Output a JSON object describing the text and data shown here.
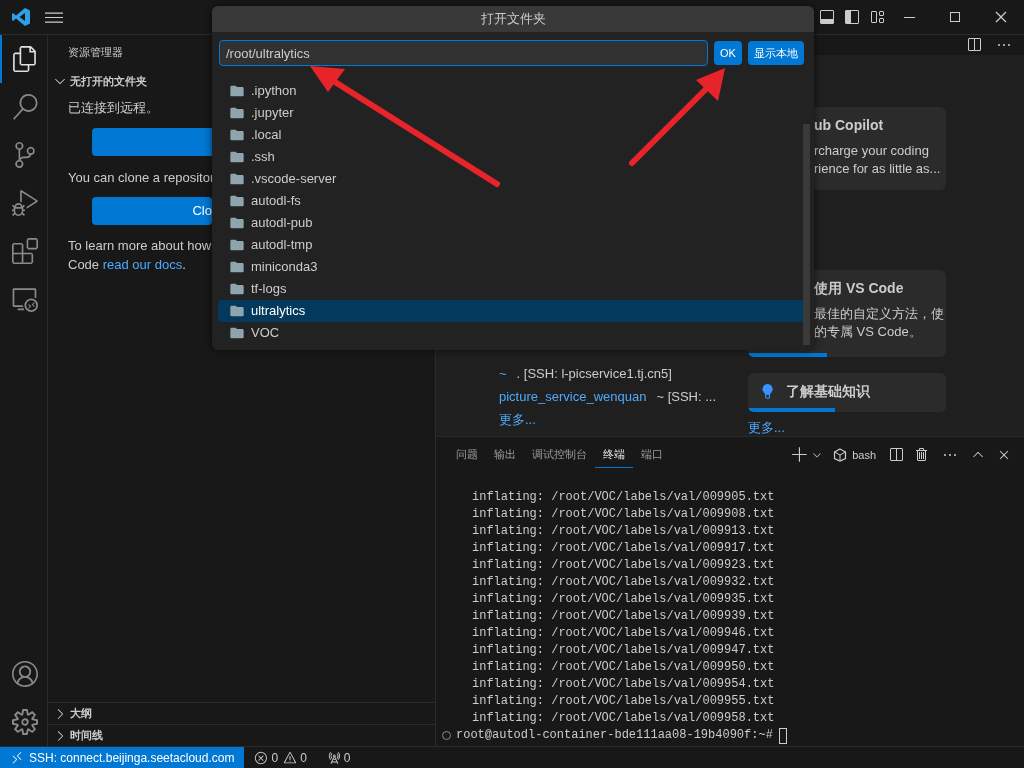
{
  "activity_bar": {
    "items": [
      {
        "kind": "files",
        "selected": true
      },
      {
        "kind": "search",
        "selected": false
      },
      {
        "kind": "source_control",
        "selected": false
      },
      {
        "kind": "run_debug",
        "selected": false
      },
      {
        "kind": "extensions",
        "selected": false
      },
      {
        "kind": "remote",
        "selected": false
      }
    ],
    "bottom": [
      {
        "kind": "account",
        "selected": false
      },
      {
        "kind": "settings",
        "selected": false
      }
    ]
  },
  "sidebar": {
    "title": "资源管理器",
    "section": {
      "label": "无打开的文件夹",
      "expanded": true
    },
    "connected_text": "已连接到远程。",
    "clone_text": "You can clone a repositor",
    "clone_button": "Clo",
    "learn_line_1": "To learn more about how",
    "learn_line_2": "Code ",
    "docs_link": "read our docs",
    "learn_end": ".",
    "bottom_sections": [
      {
        "label": "大纲",
        "expanded": false
      },
      {
        "label": "时间线",
        "expanded": false
      }
    ]
  },
  "editor": {
    "recent": [
      {
        "name": "~",
        "path": ". [SSH: l-picservice1.tj.cn5]"
      },
      {
        "name": "picture_service_wenquan",
        "path": "~ [SSH: ..."
      }
    ],
    "recent_more": "更多...",
    "walkthroughs": [
      {
        "title": "ub Copilot",
        "lines": [
          "rcharge your coding",
          "rience for as little as..."
        ]
      },
      {
        "title": "使用 VS Code",
        "lines": [
          "最佳的自定义方法，使",
          "的专属 VS Code。"
        ],
        "level": 0.4
      },
      {
        "title": "了解基础知识",
        "kind": "bulb",
        "level": 0.44
      }
    ],
    "walkthroughs_more": "更多..."
  },
  "panel": {
    "tabs": [
      {
        "label": "问题",
        "selected": false
      },
      {
        "label": "输出",
        "selected": false
      },
      {
        "label": "调试控制台",
        "selected": false
      },
      {
        "label": "终端",
        "selected": true
      },
      {
        "label": "端口",
        "selected": false
      }
    ],
    "shell": "bash",
    "lines": [
      "inflating: /root/VOC/labels/val/009905.txt",
      "inflating: /root/VOC/labels/val/009908.txt",
      "inflating: /root/VOC/labels/val/009913.txt",
      "inflating: /root/VOC/labels/val/009917.txt",
      "inflating: /root/VOC/labels/val/009923.txt",
      "inflating: /root/VOC/labels/val/009932.txt",
      "inflating: /root/VOC/labels/val/009935.txt",
      "inflating: /root/VOC/labels/val/009939.txt",
      "inflating: /root/VOC/labels/val/009946.txt",
      "inflating: /root/VOC/labels/val/009947.txt",
      "inflating: /root/VOC/labels/val/009950.txt",
      "inflating: /root/VOC/labels/val/009954.txt",
      "inflating: /root/VOC/labels/val/009955.txt",
      "inflating: /root/VOC/labels/val/009958.txt"
    ],
    "prompt": "root@autodl-container-bde111aa08-19b4090f:~#"
  },
  "status_bar": {
    "remote": "SSH: connect.beijinga.seetacloud.com",
    "errors": "0",
    "warnings": "0",
    "ports": "0"
  },
  "dialog": {
    "title": "打开文件夹",
    "value": "/root/ultralytics",
    "buttons": [
      "OK",
      "显示本地"
    ],
    "items": [
      {
        "label": ".ipython",
        "selected": false
      },
      {
        "label": ".jupyter",
        "selected": false
      },
      {
        "label": ".local",
        "selected": false
      },
      {
        "label": ".ssh",
        "selected": false
      },
      {
        "label": ".vscode-server",
        "selected": false
      },
      {
        "label": "autodl-fs",
        "selected": false
      },
      {
        "label": "autodl-pub",
        "selected": false
      },
      {
        "label": "autodl-tmp",
        "selected": false
      },
      {
        "label": "miniconda3",
        "selected": false
      },
      {
        "label": "tf-logs",
        "selected": false
      },
      {
        "label": "ultralytics",
        "selected": true
      },
      {
        "label": "VOC",
        "selected": false
      }
    ]
  }
}
